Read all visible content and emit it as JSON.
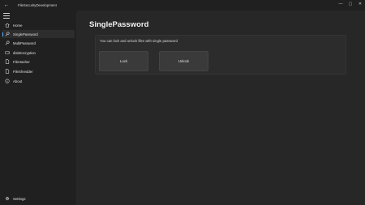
{
  "window": {
    "title": "FileSecurityDevelopment",
    "back_glyph": "←",
    "controls": {
      "minimize": "—",
      "maximize": "▢",
      "close": "✕"
    }
  },
  "sidebar": {
    "items": [
      {
        "label": "Home",
        "icon": "home-icon",
        "selected": false
      },
      {
        "label": "SinglePassword",
        "icon": "key-icon",
        "selected": true
      },
      {
        "label": "MultiPassword",
        "icon": "key-icon",
        "selected": false
      },
      {
        "label": "diskEncryption",
        "icon": "disk-icon",
        "selected": false
      },
      {
        "label": "FileHasher",
        "icon": "document-icon",
        "selected": false
      },
      {
        "label": "FileShredder",
        "icon": "document-icon",
        "selected": false
      },
      {
        "label": "About",
        "icon": "info-icon",
        "selected": false
      }
    ],
    "settings_label": "Settings"
  },
  "main": {
    "title": "SinglePassword",
    "description": "You can lock and unlock files with single password",
    "lock_label": "Lock",
    "unlock_label": "Unlock"
  },
  "colors": {
    "accent": "#5ab0ff",
    "background": "#202020",
    "content_background": "#272727",
    "card_background": "#2c2c2c",
    "button_background": "#3a3a3a"
  }
}
